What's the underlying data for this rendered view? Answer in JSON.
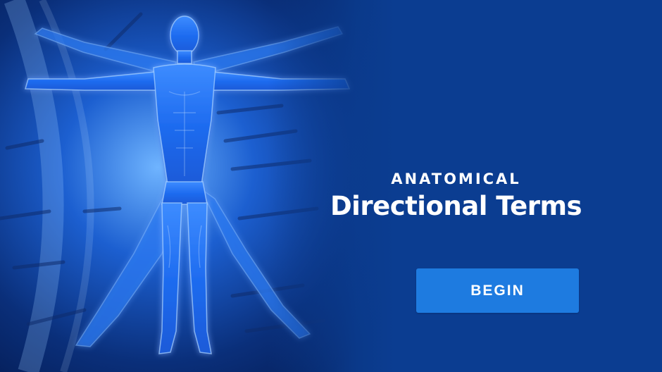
{
  "hero": {
    "image_subject": "anatomical-human-figure"
  },
  "heading": {
    "subtitle": "ANATOMICAL",
    "title": "Directional Terms"
  },
  "actions": {
    "begin_label": "BEGIN"
  },
  "colors": {
    "background": "#0b3d91",
    "button": "#1e7be0",
    "text": "#ffffff"
  }
}
